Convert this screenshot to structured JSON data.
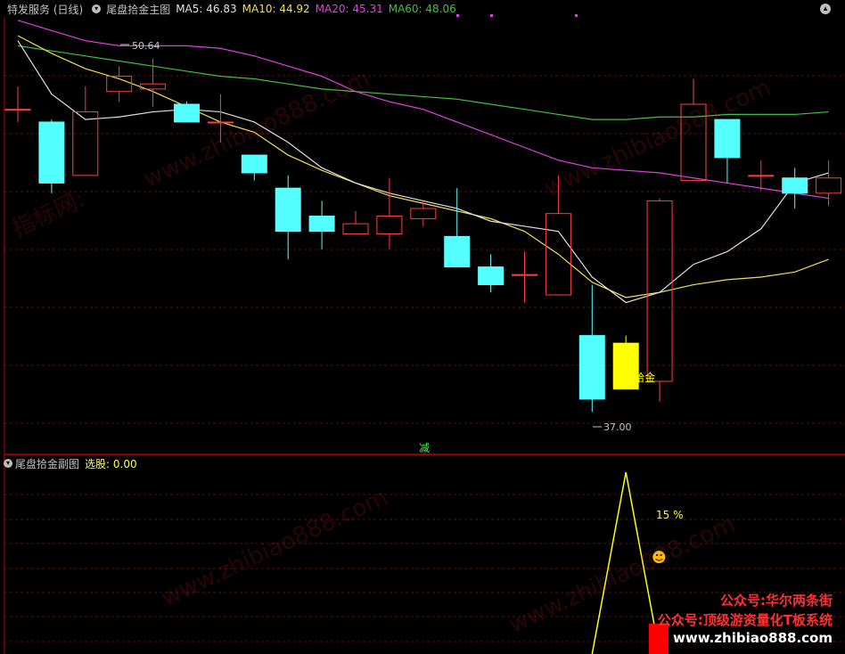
{
  "header": {
    "window_title": "特发服务 (日线)",
    "indicator_name": "尾盘拾金主图",
    "ma_items": [
      {
        "label": "MA5: 46.83",
        "color": "#e0e0e0"
      },
      {
        "label": "MA10: 44.92",
        "color": "#f0e04a"
      },
      {
        "label": "MA20: 45.31",
        "color": "#e040e0"
      },
      {
        "label": "MA60: 48.06",
        "color": "#40c040"
      }
    ]
  },
  "chart_data": {
    "type": "candlestick",
    "ylim": [
      35.5,
      52.5
    ],
    "candles": [
      {
        "o": 48.9,
        "c": 48.9,
        "h": 49.8,
        "l": 48.4
      },
      {
        "o": 48.4,
        "c": 46.0,
        "h": 48.5,
        "l": 45.6
      },
      {
        "o": 46.3,
        "c": 48.8,
        "h": 49.8,
        "l": 46.3
      },
      {
        "o": 49.6,
        "c": 50.2,
        "h": 50.6,
        "l": 49.2
      },
      {
        "o": 49.7,
        "c": 49.9,
        "h": 50.9,
        "l": 49.0
      },
      {
        "o": 49.1,
        "c": 48.4,
        "h": 49.2,
        "l": 48.4
      },
      {
        "o": 48.4,
        "c": 48.4,
        "h": 49.5,
        "l": 47.6
      },
      {
        "o": 47.1,
        "c": 46.4,
        "h": 47.1,
        "l": 46.1
      },
      {
        "o": 45.8,
        "c": 44.1,
        "h": 46.3,
        "l": 43.0
      },
      {
        "o": 44.7,
        "c": 44.1,
        "h": 45.3,
        "l": 43.4
      },
      {
        "o": 44.0,
        "c": 44.4,
        "h": 44.9,
        "l": 44.0
      },
      {
        "o": 44.0,
        "c": 44.7,
        "h": 46.2,
        "l": 43.4
      },
      {
        "o": 44.6,
        "c": 45.0,
        "h": 45.3,
        "l": 44.3
      },
      {
        "o": 43.9,
        "c": 42.7,
        "h": 45.8,
        "l": 42.7
      },
      {
        "o": 42.7,
        "c": 42.0,
        "h": 43.2,
        "l": 41.7
      },
      {
        "o": 42.4,
        "c": 42.4,
        "h": 43.3,
        "l": 41.3
      },
      {
        "o": 41.6,
        "c": 44.8,
        "h": 46.3,
        "l": 41.6
      },
      {
        "o": 40.0,
        "c": 37.5,
        "h": 42.0,
        "l": 37.0
      },
      {
        "o": 37.9,
        "c": 39.7,
        "h": 40.0,
        "l": 37.9
      },
      {
        "o": 38.2,
        "c": 45.3,
        "h": 45.4,
        "l": 37.4
      },
      {
        "o": 46.1,
        "c": 49.1,
        "h": 50.1,
        "l": 46.1
      },
      {
        "o": 48.5,
        "c": 47.0,
        "h": 48.5,
        "l": 46.0
      },
      {
        "o": 46.3,
        "c": 46.3,
        "h": 46.9,
        "l": 45.7
      },
      {
        "o": 46.2,
        "c": 45.6,
        "h": 46.6,
        "l": 45.0
      },
      {
        "o": 45.6,
        "c": 46.2,
        "h": 46.9,
        "l": 45.1
      }
    ],
    "ma5": [
      51.6,
      49.5,
      48.5,
      48.6,
      48.8,
      48.9,
      48.8,
      48.4,
      47.6,
      46.6,
      46.0,
      45.6,
      45.3,
      45.0,
      44.5,
      44.3,
      44.1,
      42.3,
      41.3,
      41.7,
      42.8,
      43.3,
      44.2,
      46.0,
      46.4
    ],
    "ma10": [
      51.8,
      51.1,
      50.5,
      50.1,
      49.6,
      49.0,
      48.4,
      48.0,
      47.1,
      46.5,
      46.0,
      45.5,
      45.2,
      44.9,
      44.6,
      44.1,
      43.2,
      42.1,
      41.5,
      41.7,
      42.0,
      42.2,
      42.3,
      42.5,
      43.0
    ],
    "ma20": [
      52.4,
      52.0,
      51.6,
      51.4,
      51.4,
      51.4,
      51.3,
      51.0,
      50.6,
      50.2,
      49.6,
      49.2,
      48.9,
      48.4,
      47.9,
      47.4,
      46.9,
      46.6,
      46.5,
      46.4,
      46.2,
      46.0,
      45.8,
      45.6,
      45.4
    ],
    "ma60": [
      51.4,
      51.2,
      51.0,
      50.8,
      50.6,
      50.4,
      50.2,
      50.1,
      49.9,
      49.7,
      49.6,
      49.5,
      49.4,
      49.3,
      49.1,
      48.9,
      48.7,
      48.5,
      48.5,
      48.6,
      48.6,
      48.7,
      48.7,
      48.7,
      48.8
    ],
    "annotations": {
      "high_label": "50.64",
      "low_label": "37.00",
      "signal_label": "▲拾金"
    },
    "sub": {
      "line_values": [
        0,
        0,
        0,
        0,
        0,
        0,
        0,
        0,
        0,
        0,
        0,
        0,
        0,
        0,
        0,
        0,
        0,
        0,
        0,
        0,
        0,
        0,
        0,
        0,
        0
      ],
      "peak_index": 18,
      "peak_value": 100,
      "pct_label": "15    %",
      "smile": "☻"
    }
  },
  "sub_header": {
    "indicator_name": "尾盘拾金副图",
    "select_label": "选股: 0.00"
  },
  "divider_marker": "减",
  "watermarks": [
    "www.zhibiao888.com",
    "指标网:"
  ],
  "promo": {
    "line1": "公众号:华尔两条街",
    "line2": "公众号:顶级游资量化T板系统",
    "line3": "www.zhibiao888.com"
  },
  "colors": {
    "up": "#ff4040",
    "down": "#54ffff",
    "signal": "#ffff00",
    "grid": "#7a0000",
    "divider": "#c00000"
  }
}
